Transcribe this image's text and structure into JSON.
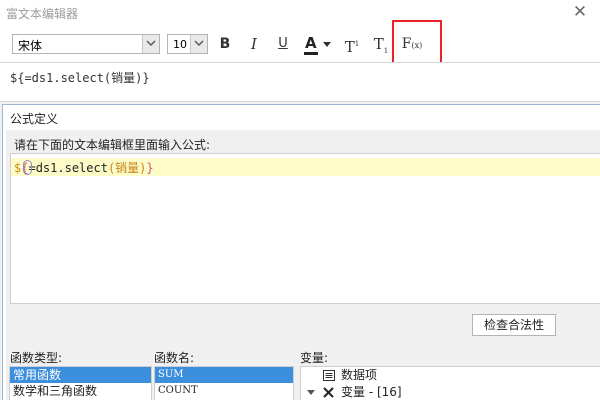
{
  "window": {
    "title": "富文本编辑器",
    "close_symbol": "✕"
  },
  "toolbar": {
    "font_family": "宋体",
    "font_size": "10",
    "bold_label": "B",
    "italic_label": "I",
    "underline_label": "U",
    "color_label": "A",
    "superscript_base": "T",
    "superscript_mark": "1",
    "subscript_base": "T",
    "subscript_mark": "1",
    "formula_base": "F",
    "formula_mark": "(x)",
    "highlight_color": "#e8242a"
  },
  "editor": {
    "content": "${=ds1.select(销量)}"
  },
  "formula_dialog": {
    "title": "公式定义",
    "instruction": "请在下面的文本编辑框里面输入公式:",
    "code": {
      "dollar": "$",
      "open_brace": "{",
      "body": "=ds1.select",
      "argument": "(销量)",
      "close_brace": "}"
    },
    "check_button": "检查合法性",
    "function_type": {
      "label": "函数类型:",
      "items": [
        "常用函数",
        "数学和三角函数"
      ],
      "selected_index": 0
    },
    "function_name": {
      "label": "函数名:",
      "items": [
        "SUM",
        "COUNT"
      ],
      "selected_index": 0
    },
    "variables": {
      "label": "变量:",
      "items": [
        {
          "icon": "list-icon",
          "label": "数据项"
        },
        {
          "icon": "variable-x-icon",
          "label": "变量 - [16]"
        }
      ]
    }
  }
}
